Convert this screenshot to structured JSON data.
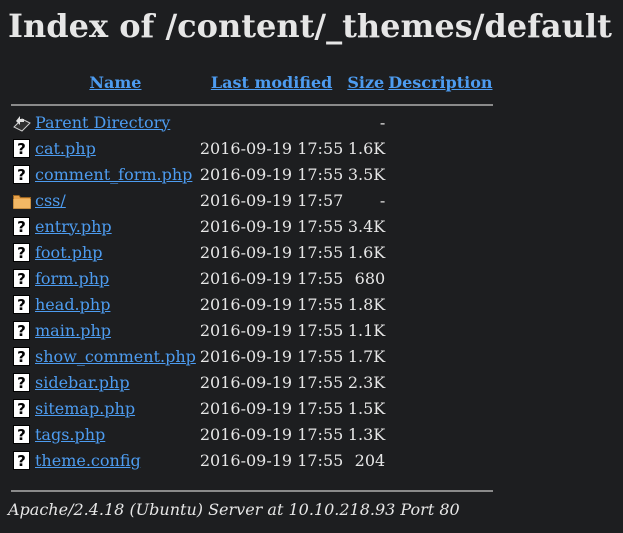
{
  "title": "Index of /content/_themes/default",
  "columns": {
    "name": "Name",
    "modified": "Last modified",
    "size": "Size",
    "description": "Description"
  },
  "rows": [
    {
      "icon": "back-icon",
      "name": "Parent Directory",
      "modified": "",
      "size": "-",
      "description": ""
    },
    {
      "icon": "unknown-file-icon",
      "name": "cat.php",
      "modified": "2016-09-19 17:55",
      "size": "1.6K",
      "description": ""
    },
    {
      "icon": "unknown-file-icon",
      "name": "comment_form.php",
      "modified": "2016-09-19 17:55",
      "size": "3.5K",
      "description": ""
    },
    {
      "icon": "folder-icon",
      "name": "css/",
      "modified": "2016-09-19 17:57",
      "size": "-",
      "description": ""
    },
    {
      "icon": "unknown-file-icon",
      "name": "entry.php",
      "modified": "2016-09-19 17:55",
      "size": "3.4K",
      "description": ""
    },
    {
      "icon": "unknown-file-icon",
      "name": "foot.php",
      "modified": "2016-09-19 17:55",
      "size": "1.6K",
      "description": ""
    },
    {
      "icon": "unknown-file-icon",
      "name": "form.php",
      "modified": "2016-09-19 17:55",
      "size": "680",
      "description": ""
    },
    {
      "icon": "unknown-file-icon",
      "name": "head.php",
      "modified": "2016-09-19 17:55",
      "size": "1.8K",
      "description": ""
    },
    {
      "icon": "unknown-file-icon",
      "name": "main.php",
      "modified": "2016-09-19 17:55",
      "size": "1.1K",
      "description": ""
    },
    {
      "icon": "unknown-file-icon",
      "name": "show_comment.php",
      "modified": "2016-09-19 17:55",
      "size": "1.7K",
      "description": ""
    },
    {
      "icon": "unknown-file-icon",
      "name": "sidebar.php",
      "modified": "2016-09-19 17:55",
      "size": "2.3K",
      "description": ""
    },
    {
      "icon": "unknown-file-icon",
      "name": "sitemap.php",
      "modified": "2016-09-19 17:55",
      "size": "1.5K",
      "description": ""
    },
    {
      "icon": "unknown-file-icon",
      "name": "tags.php",
      "modified": "2016-09-19 17:55",
      "size": "1.3K",
      "description": ""
    },
    {
      "icon": "unknown-file-icon",
      "name": "theme.config",
      "modified": "2016-09-19 17:55",
      "size": "204",
      "description": ""
    }
  ],
  "footer": "Apache/2.4.18 (Ubuntu) Server at 10.10.218.93 Port 80",
  "colors": {
    "background": "#1d1e20",
    "text": "#e6e6e6",
    "link": "#4d9cf0",
    "rule": "#8a8a8a"
  }
}
